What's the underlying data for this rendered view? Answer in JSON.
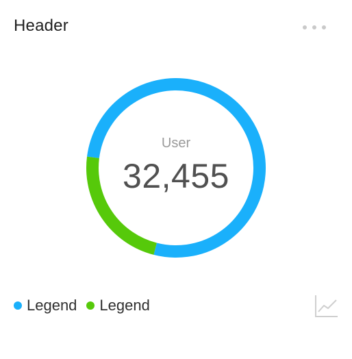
{
  "header": {
    "title": "Header",
    "more_icon": "more-horizontal-icon"
  },
  "chart_data": {
    "type": "pie",
    "style": "donut",
    "center_label": "User",
    "center_value": "32,455",
    "series": [
      {
        "name": "Legend",
        "value": 77,
        "color": "#1ab0fb"
      },
      {
        "name": "Legend",
        "value": 23,
        "color": "#56c90a"
      }
    ],
    "legend_position": "bottom-left"
  },
  "footer": {
    "chart_icon": "line-chart-icon"
  }
}
